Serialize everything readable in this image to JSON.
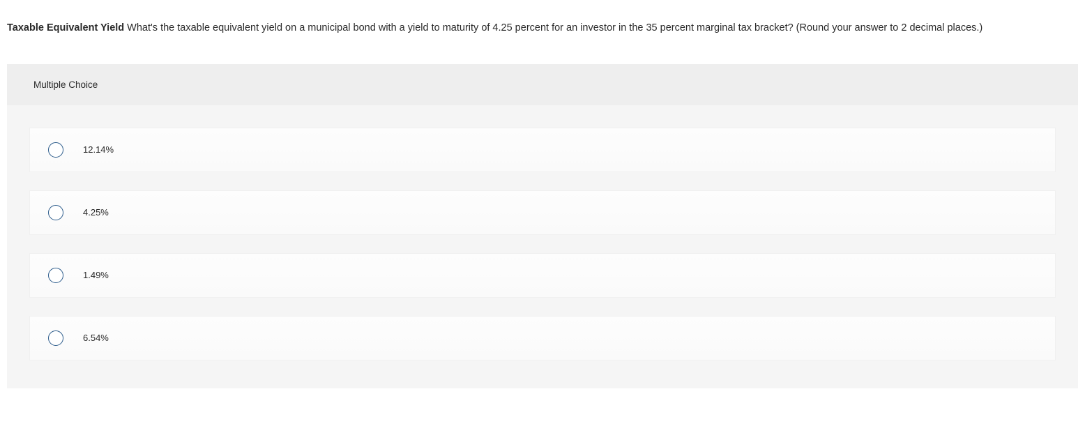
{
  "question": {
    "bold_prefix": "Taxable Equivalent Yield",
    "text": " What's the taxable equivalent yield on a municipal bond with a yield to maturity of 4.25 percent for an investor in the 35 percent marginal tax bracket? (Round your answer to 2 decimal places.)"
  },
  "section_label": "Multiple Choice",
  "options": [
    {
      "label": "12.14%"
    },
    {
      "label": "4.25%"
    },
    {
      "label": "1.49%"
    },
    {
      "label": "6.54%"
    }
  ]
}
